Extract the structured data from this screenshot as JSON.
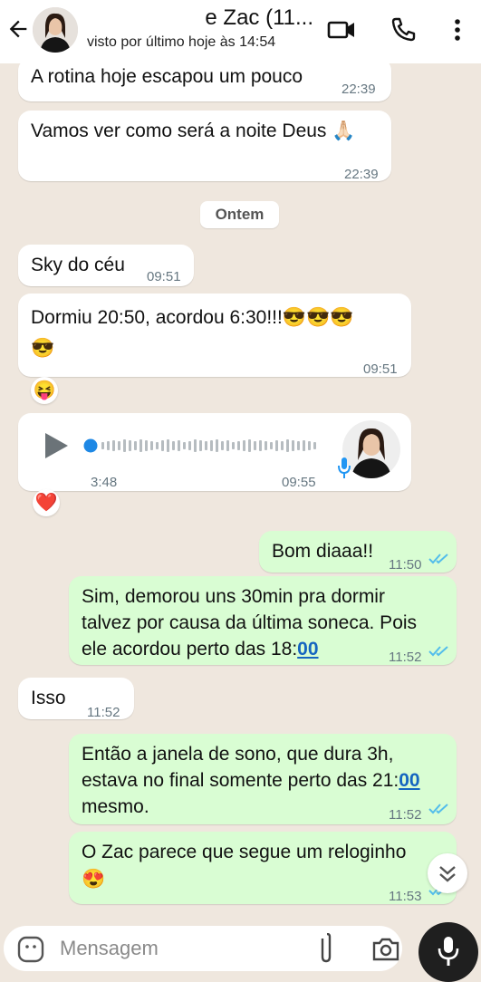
{
  "header": {
    "contact_name": "e Zac (11...",
    "last_seen": "visto por último hoje às 14:54"
  },
  "date_separator": "Ontem",
  "messages": [
    {
      "text": "A rotina hoje escapou um pouco",
      "time": "22:39"
    },
    {
      "text": "Vamos ver como será a noite Deus 🙏🏻",
      "time": "22:39"
    },
    {
      "text": "Sky do céu",
      "time": "09:51"
    },
    {
      "text_line1": "Dormiu 20:50, acordou 6:30!!!😎😎😎",
      "text_line2": "😎",
      "time": "09:51",
      "reaction": "😝"
    },
    {
      "duration": "3:48",
      "time": "09:55",
      "reaction": "❤️"
    },
    {
      "text": "Bom diaaa!!",
      "time": "11:50"
    },
    {
      "line1": "Sim, demorou uns 30min pra dormir",
      "line2": "talvez por causa da última soneca. Pois",
      "line3_prefix": "ele acordou perto das 18:",
      "line3_link": "00",
      "time": "11:52"
    },
    {
      "text": "Isso",
      "time": "11:52"
    },
    {
      "line1": "Então a janela de sono, que dura 3h,",
      "line2_prefix": "estava no final somente perto das 21:",
      "line2_link": "00",
      "line3": "mesmo.",
      "time": "11:52"
    },
    {
      "line1": "O Zac parece que segue um reloginho",
      "line2": "😍",
      "time": "11:53"
    }
  ],
  "composer": {
    "placeholder": "Mensagem"
  },
  "colors": {
    "incoming": "#ffffff",
    "outgoing": "#d9fdd3",
    "read_ticks": "#53bdeb",
    "link": "#1565c0"
  }
}
